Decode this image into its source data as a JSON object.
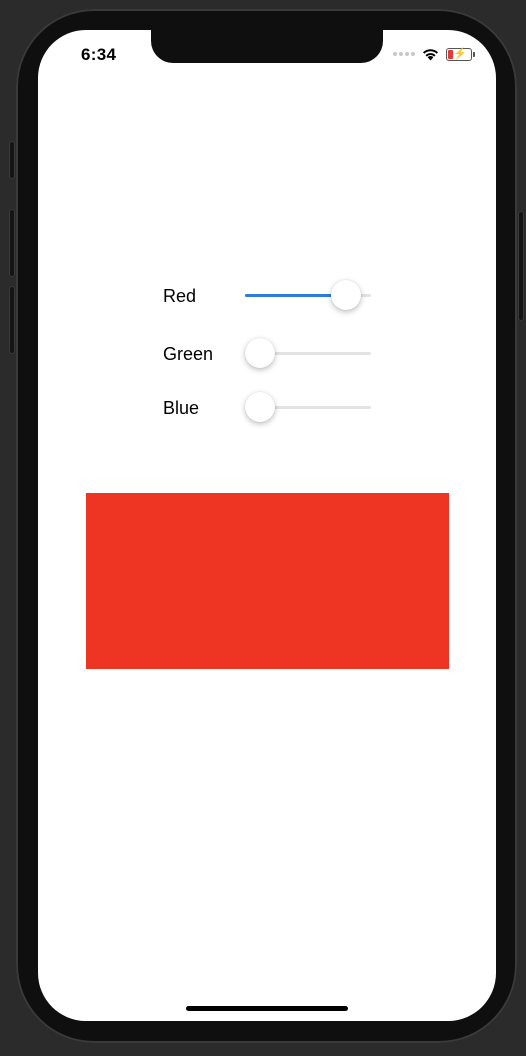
{
  "status_bar": {
    "time": "6:34",
    "wifi_icon": "wifi-icon",
    "battery_icon": "battery-charging-icon"
  },
  "sliders": [
    {
      "label": "Red",
      "value": 0.9,
      "filled": true
    },
    {
      "label": "Green",
      "value": 0.0,
      "filled": false
    },
    {
      "label": "Blue",
      "value": 0.0,
      "filled": false
    }
  ],
  "preview": {
    "color": "#ee3524"
  },
  "colors": {
    "accent": "#2e7be0",
    "track": "#e3e3e3"
  }
}
